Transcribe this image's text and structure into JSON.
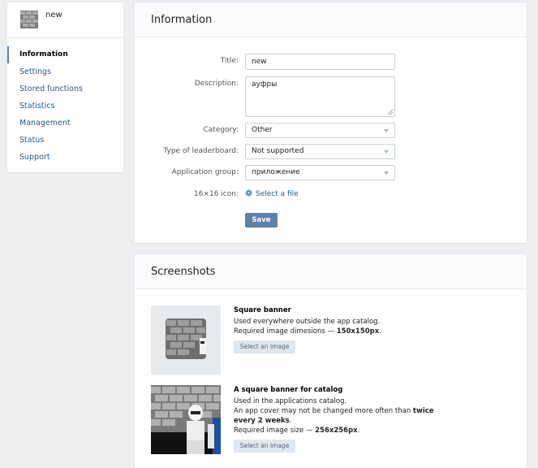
{
  "app": {
    "name": "new"
  },
  "sidebar": {
    "items": [
      {
        "label": "Information",
        "active": true
      },
      {
        "label": "Settings"
      },
      {
        "label": "Stored functions"
      },
      {
        "label": "Statistics"
      },
      {
        "label": "Management"
      },
      {
        "label": "Status"
      },
      {
        "label": "Support"
      }
    ]
  },
  "info": {
    "heading": "Information",
    "title_label": "Title:",
    "title_value": "new",
    "description_label": "Description:",
    "description_value": "ауфры",
    "category_label": "Category:",
    "category_value": "Other",
    "leaderboard_label": "Type of leaderboard:",
    "leaderboard_value": "Not supported",
    "group_label": "Application group:",
    "group_value": "приложение",
    "icon_label": "16×16 icon:",
    "icon_action": "Select a file",
    "save_label": "Save"
  },
  "screenshots": {
    "heading": "Screenshots",
    "square": {
      "title": "Square banner",
      "line1": "Used everywhere outside the app catalog.",
      "line2_prefix": "Required image dimesions — ",
      "line2_bold": "150x150px",
      "line2_suffix": ".",
      "button": "Select an image"
    },
    "catalog": {
      "title": "A square banner for catalog",
      "line1": "Used in the applications catalog.",
      "line2_prefix": "An app cover may not be changed more often than ",
      "line2_bold": "twice every 2 weeks",
      "line2_suffix": ".",
      "line3_prefix": "Required image size — ",
      "line3_bold": "256x256px",
      "line3_suffix": ".",
      "button": "Select an image"
    }
  },
  "colors": {
    "accent": "#5181b8",
    "link": "#2a5885",
    "button": "#5e81a8",
    "bg": "#edeef0"
  }
}
